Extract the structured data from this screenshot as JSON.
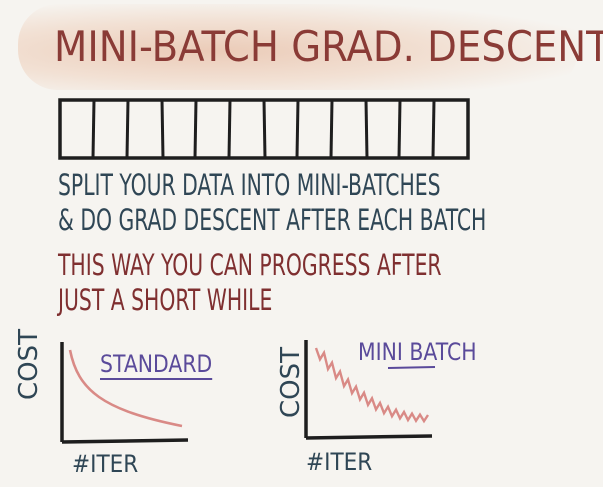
{
  "title": "MINI-BATCH GRAD. DESCENT",
  "text_lines": [
    "SPLIT YOUR DATA INTO MINI-BATCHES",
    "& DO GRAD DESCENT AFTER EACH BATCH",
    "THIS WAY YOU CAN PROGRESS AFTER",
    "JUST A SHORT WHILE"
  ],
  "batch_cells": 12,
  "left_chart": {
    "label": "STANDARD",
    "ylabel": "COST",
    "xlabel": "#ITER"
  },
  "right_chart": {
    "label": "MINI BATCH",
    "ylabel": "COST",
    "xlabel": "#ITER"
  },
  "colors": {
    "title": "#8a3b36",
    "teal_ink": "#2f4655",
    "red_ink": "#7f2f30",
    "purple_ink": "#5a4a9a",
    "curve": "#d98a86"
  }
}
